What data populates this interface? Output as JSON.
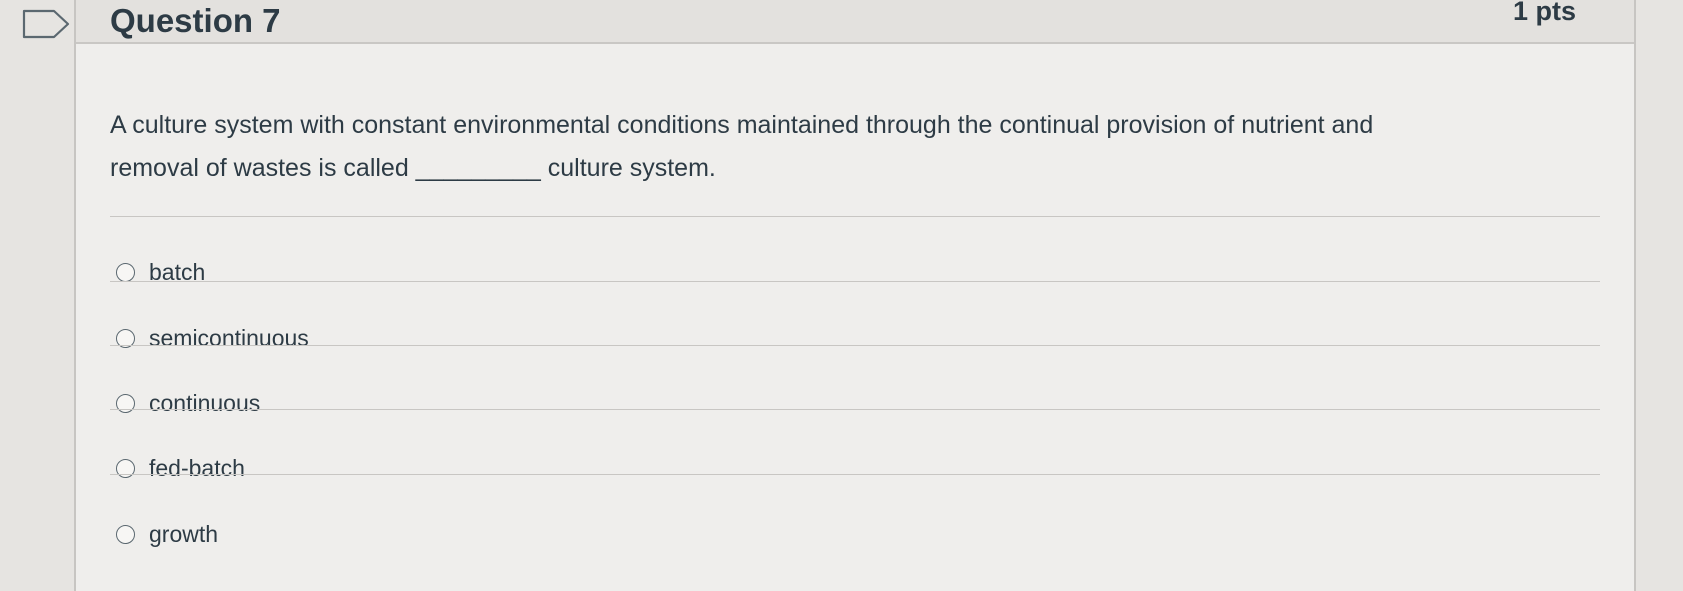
{
  "question": {
    "title": "Question 7",
    "points": "1 pts",
    "text_line1": "A culture system with constant environmental conditions maintained through the continual provision of nutrient and",
    "text_line2": "removal of wastes is called _________ culture system."
  },
  "answers": [
    {
      "label": "batch",
      "selected": false
    },
    {
      "label": "semicontinuous",
      "selected": false
    },
    {
      "label": "continuous",
      "selected": false
    },
    {
      "label": "fed-batch",
      "selected": false
    },
    {
      "label": "growth",
      "selected": false
    }
  ],
  "colors": {
    "background": "#e6e4e1",
    "card": "#efeeec",
    "text": "#2d3b45",
    "divider": "#c8c6c3"
  }
}
